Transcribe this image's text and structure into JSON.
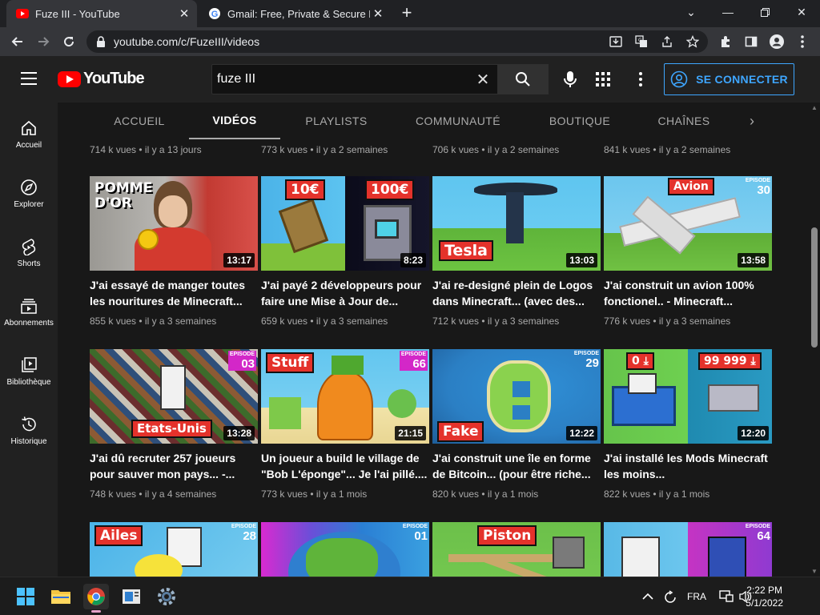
{
  "browser": {
    "tabs": [
      {
        "title": "Fuze III - YouTube",
        "active": true
      },
      {
        "title": "Gmail: Free, Private & Secure Em",
        "active": false
      }
    ],
    "url": "youtube.com/c/FuzeIII/videos"
  },
  "header": {
    "logo_text": "YouTube",
    "search_value": "fuze III",
    "signin_label": "SE CONNECTER"
  },
  "guide": {
    "items": [
      {
        "label": "Accueil",
        "icon": "home-icon"
      },
      {
        "label": "Explorer",
        "icon": "compass-icon"
      },
      {
        "label": "Shorts",
        "icon": "shorts-icon"
      },
      {
        "label": "Abonnements",
        "icon": "subscriptions-icon"
      },
      {
        "label": "Bibliothèque",
        "icon": "library-icon"
      },
      {
        "label": "Historique",
        "icon": "history-icon"
      }
    ]
  },
  "channel_tabs": [
    "ACCUEIL",
    "VIDÉOS",
    "PLAYLISTS",
    "COMMUNAUTÉ",
    "BOUTIQUE",
    "CHAÎNES"
  ],
  "active_tab": "VIDÉOS",
  "top_row_meta": [
    "714 k vues • il y a 13 jours",
    "773 k vues • il y a 2 semaines",
    "706 k vues • il y a 2 semaines",
    "841 k vues • il y a 2 semaines"
  ],
  "videos": [
    {
      "title": "J'ai essayé de manger toutes les nouritures de Minecraft...",
      "meta": "855 k vues • il y a 3 semaines",
      "duration": "13:17",
      "thumb_text": "POMME D'OR",
      "episode": ""
    },
    {
      "title": "J'ai payé 2 développeurs pour faire une Mise à Jour de...",
      "meta": "659 k vues • il y a 3 semaines",
      "duration": "8:23",
      "thumb_text": "10€",
      "thumb_text2": "100€",
      "episode": ""
    },
    {
      "title": "J'ai re-designé plein de Logos dans Minecraft... (avec des...",
      "meta": "712 k vues • il y a 3 semaines",
      "duration": "13:03",
      "thumb_text": "Tesla",
      "episode": ""
    },
    {
      "title": "J'ai construit un avion 100% fonctionel.. - Minecraft...",
      "meta": "776 k vues • il y a 3 semaines",
      "duration": "13:58",
      "thumb_text": "Avion",
      "episode": "30"
    },
    {
      "title": "J'ai dû recruter 257 joueurs pour sauver mon pays... -...",
      "meta": "748 k vues • il y a 4 semaines",
      "duration": "13:28",
      "thumb_text": "Etats-Unis",
      "episode": "03"
    },
    {
      "title": "Un joueur a build le village de \"Bob L'éponge\"... Je l'ai pillé....",
      "meta": "773 k vues • il y a 1 mois",
      "duration": "21:15",
      "thumb_text": "Stuff",
      "episode": "66"
    },
    {
      "title": "J'ai construit une île en forme de Bitcoin... (pour être riche...",
      "meta": "820 k vues • il y a 1 mois",
      "duration": "12:22",
      "thumb_text": "Fake",
      "episode": "29"
    },
    {
      "title": "J'ai installé les Mods Minecraft les moins...",
      "meta": "822 k vues • il y a 1 mois",
      "duration": "12:20",
      "thumb_text": "0",
      "thumb_text2": "99 999",
      "episode": ""
    },
    {
      "title": "",
      "meta": "",
      "duration": "",
      "thumb_text": "Ailes",
      "episode": "28"
    },
    {
      "title": "",
      "meta": "",
      "duration": "",
      "thumb_text": "",
      "episode": "01"
    },
    {
      "title": "",
      "meta": "",
      "duration": "",
      "thumb_text": "Piston",
      "episode": ""
    },
    {
      "title": "",
      "meta": "",
      "duration": "",
      "thumb_text": "",
      "episode": "64"
    }
  ],
  "episode_word": "EPISODE",
  "taskbar": {
    "lang": "FRA",
    "time": "2:22 PM",
    "date": "5/1/2022"
  },
  "colors": {
    "accent_blue": "#3ea6ff",
    "brand_red": "#ff0000",
    "label_red": "#e4322b"
  }
}
